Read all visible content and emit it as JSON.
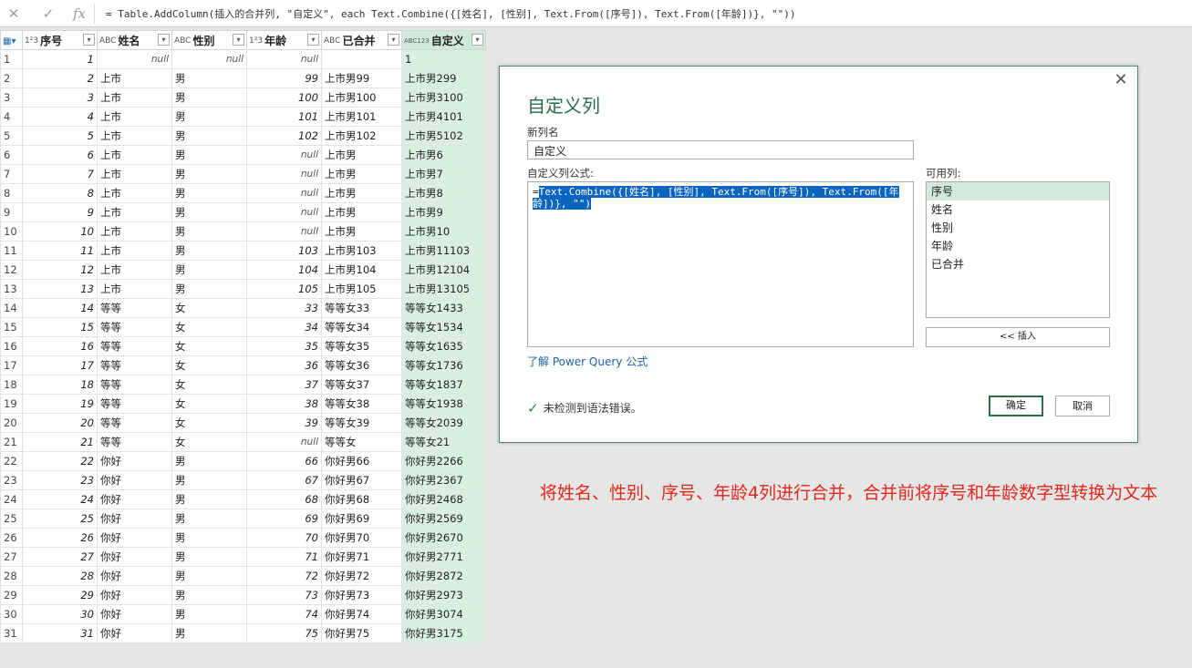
{
  "formula_bar": {
    "cancel_glyph": "✕",
    "confirm_glyph": "✓",
    "fx_glyph": "fx",
    "formula": "= Table.AddColumn(插入的合并列, \"自定义\", each Text.Combine({[姓名], [性别], Text.From([序号]), Text.From([年龄])}, \"\"))"
  },
  "grid": {
    "columns": [
      {
        "type": "1²3",
        "name": "序号"
      },
      {
        "type": "ABC",
        "name": "姓名"
      },
      {
        "type": "ABC",
        "name": "性别"
      },
      {
        "type": "1²3",
        "name": "年龄"
      },
      {
        "type": "ABC",
        "name": "已合并"
      },
      {
        "type": "ABC123",
        "name": "自定义"
      }
    ],
    "rows": [
      [
        "1",
        "1",
        "null",
        "null",
        "null",
        "",
        "1"
      ],
      [
        "2",
        "2",
        "上市",
        "男",
        "99",
        "上市男99",
        "上市男299"
      ],
      [
        "3",
        "3",
        "上市",
        "男",
        "100",
        "上市男100",
        "上市男3100"
      ],
      [
        "4",
        "4",
        "上市",
        "男",
        "101",
        "上市男101",
        "上市男4101"
      ],
      [
        "5",
        "5",
        "上市",
        "男",
        "102",
        "上市男102",
        "上市男5102"
      ],
      [
        "6",
        "6",
        "上市",
        "男",
        "null",
        "上市男",
        "上市男6"
      ],
      [
        "7",
        "7",
        "上市",
        "男",
        "null",
        "上市男",
        "上市男7"
      ],
      [
        "8",
        "8",
        "上市",
        "男",
        "null",
        "上市男",
        "上市男8"
      ],
      [
        "9",
        "9",
        "上市",
        "男",
        "null",
        "上市男",
        "上市男9"
      ],
      [
        "10",
        "10",
        "上市",
        "男",
        "null",
        "上市男",
        "上市男10"
      ],
      [
        "11",
        "11",
        "上市",
        "男",
        "103",
        "上市男103",
        "上市男11103"
      ],
      [
        "12",
        "12",
        "上市",
        "男",
        "104",
        "上市男104",
        "上市男12104"
      ],
      [
        "13",
        "13",
        "上市",
        "男",
        "105",
        "上市男105",
        "上市男13105"
      ],
      [
        "14",
        "14",
        "等等",
        "女",
        "33",
        "等等女33",
        "等等女1433"
      ],
      [
        "15",
        "15",
        "等等",
        "女",
        "34",
        "等等女34",
        "等等女1534"
      ],
      [
        "16",
        "16",
        "等等",
        "女",
        "35",
        "等等女35",
        "等等女1635"
      ],
      [
        "17",
        "17",
        "等等",
        "女",
        "36",
        "等等女36",
        "等等女1736"
      ],
      [
        "18",
        "18",
        "等等",
        "女",
        "37",
        "等等女37",
        "等等女1837"
      ],
      [
        "19",
        "19",
        "等等",
        "女",
        "38",
        "等等女38",
        "等等女1938"
      ],
      [
        "20",
        "20",
        "等等",
        "女",
        "39",
        "等等女39",
        "等等女2039"
      ],
      [
        "21",
        "21",
        "等等",
        "女",
        "null",
        "等等女",
        "等等女21"
      ],
      [
        "22",
        "22",
        "你好",
        "男",
        "66",
        "你好男66",
        "你好男2266"
      ],
      [
        "23",
        "23",
        "你好",
        "男",
        "67",
        "你好男67",
        "你好男2367"
      ],
      [
        "24",
        "24",
        "你好",
        "男",
        "68",
        "你好男68",
        "你好男2468"
      ],
      [
        "25",
        "25",
        "你好",
        "男",
        "69",
        "你好男69",
        "你好男2569"
      ],
      [
        "26",
        "26",
        "你好",
        "男",
        "70",
        "你好男70",
        "你好男2670"
      ],
      [
        "27",
        "27",
        "你好",
        "男",
        "71",
        "你好男71",
        "你好男2771"
      ],
      [
        "28",
        "28",
        "你好",
        "男",
        "72",
        "你好男72",
        "你好男2872"
      ],
      [
        "29",
        "29",
        "你好",
        "男",
        "73",
        "你好男73",
        "你好男2973"
      ],
      [
        "30",
        "30",
        "你好",
        "男",
        "74",
        "你好男74",
        "你好男3074"
      ],
      [
        "31",
        "31",
        "你好",
        "男",
        "75",
        "你好男75",
        "你好男3175"
      ]
    ]
  },
  "dialog": {
    "title": "自定义列",
    "new_col_label": "新列名",
    "new_col_value": "自定义",
    "formula_label": "自定义列公式:",
    "formula_prefix": "=",
    "formula_selected": "Text.Combine({[姓名], [性别], Text.From([序号]), Text.From([年龄])}, \"\")",
    "available_label": "可用列:",
    "available_columns": [
      "序号",
      "姓名",
      "性别",
      "年龄",
      "已合并"
    ],
    "insert_button": "<< 插入",
    "learn_link": "了解 Power Query 公式",
    "status": "未检测到语法错误。",
    "ok_button": "确定",
    "cancel_button": "取消",
    "close_glyph": "✕"
  },
  "annotation": "将姓名、性别、序号、年龄4列进行合并，合并前将序号和年龄数字型转换为文本",
  "colors": {
    "accent": "#2a6e47",
    "highlight": "#d9f0e1",
    "annotation": "#e0281c"
  }
}
